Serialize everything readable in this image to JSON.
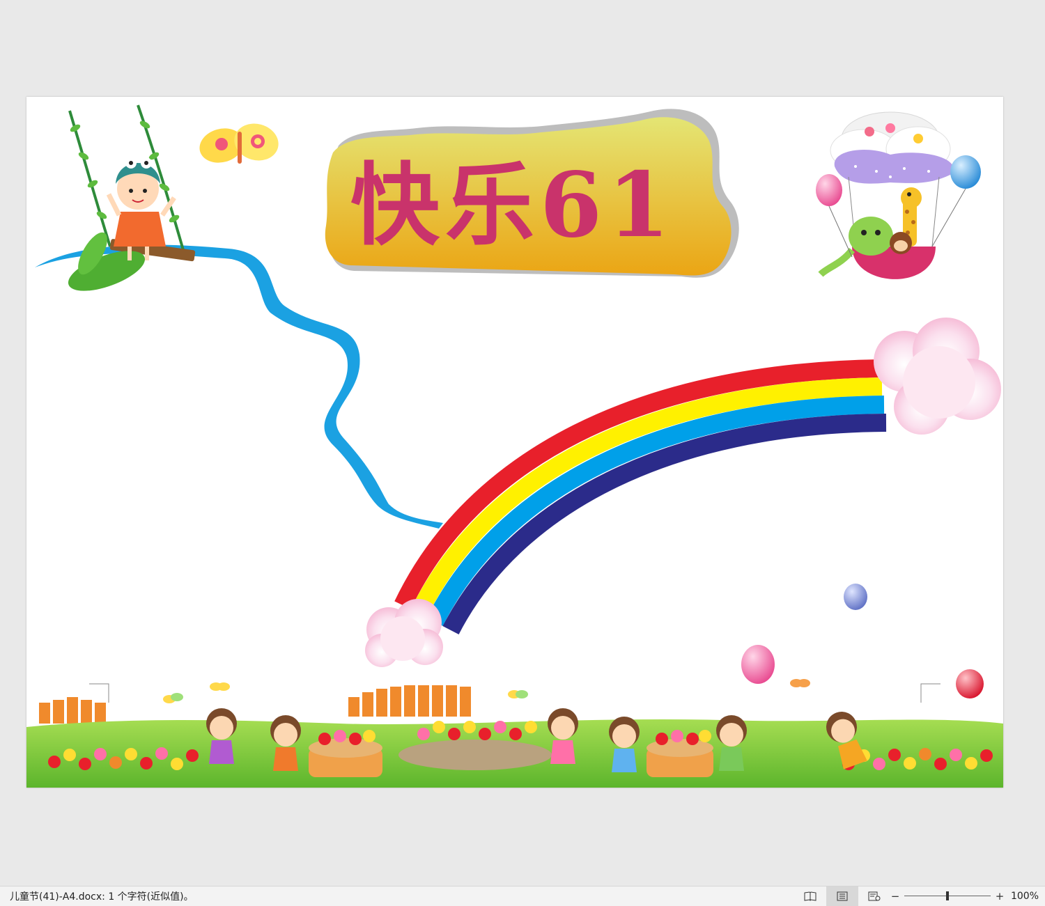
{
  "document": {
    "title_text": "快乐61",
    "title_chars": [
      "快",
      "乐",
      "6",
      "1"
    ]
  },
  "statusbar": {
    "doc_info": "儿童节(41)-A4.docx: 1 个字符(近似值)。",
    "zoom_minus": "−",
    "zoom_plus": "+",
    "zoom_level": "100%"
  },
  "view_buttons": [
    {
      "name": "read-mode",
      "icon": "book-icon",
      "active": false
    },
    {
      "name": "print-layout",
      "icon": "page-lines-icon",
      "active": true
    },
    {
      "name": "web-layout",
      "icon": "web-page-icon",
      "active": false
    }
  ],
  "colors": {
    "rainbow": [
      "#e8202b",
      "#fff100",
      "#00a0e9",
      "#2b2b8a"
    ],
    "river": "#1ba1e2",
    "title_fill": "#c9336b",
    "title_bg_top": "#e5e36f",
    "title_bg_bottom": "#eaa617",
    "grass": "#7bc93a"
  }
}
